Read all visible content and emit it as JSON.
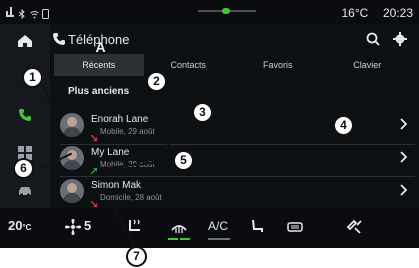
{
  "status_bar": {
    "temperature": "16°C",
    "time": "20:23"
  },
  "app": {
    "title": "Téléphone",
    "icons": [
      "phone-icon",
      "search-icon",
      "gear-icon"
    ]
  },
  "tabs": [
    {
      "label": "Récents",
      "active": true
    },
    {
      "label": "Contacts",
      "active": false
    },
    {
      "label": "Favoris",
      "active": false
    },
    {
      "label": "Clavier",
      "active": false
    }
  ],
  "list": {
    "section_title": "Plus anciens",
    "items": [
      {
        "name": "Enorah Lane",
        "detail": "Mobile, 29 août",
        "call_type": "missed"
      },
      {
        "name": "My Lane",
        "detail": "Mobile, 29 août",
        "call_type": "outgoing"
      },
      {
        "name": "Simon Mak",
        "detail": "Domicile, 28 août",
        "call_type": "missed"
      }
    ]
  },
  "bottom_bar": {
    "left_temp": "20",
    "left_temp_small": "°C",
    "fan_level": "5",
    "ac_label": "A/C"
  },
  "callouts": [
    "A",
    "1",
    "2",
    "3",
    "4",
    "5",
    "6",
    "7"
  ],
  "colors": {
    "accent": "#48c23a",
    "missed": "#e04545",
    "outgoing": "#33b24a"
  }
}
